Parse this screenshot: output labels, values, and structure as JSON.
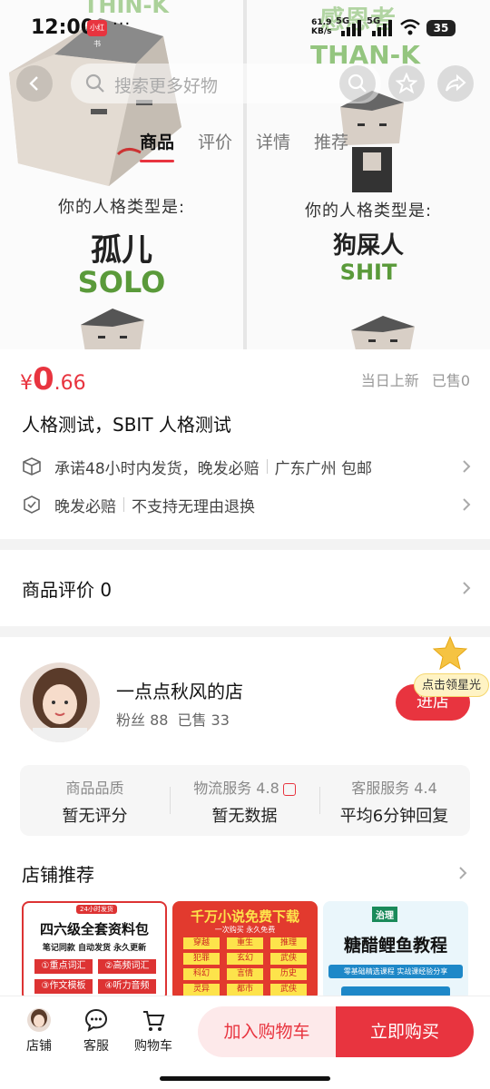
{
  "status_bar": {
    "time": "12:00",
    "app_badge": "小红书",
    "dots": "···",
    "speed_value": "61.9",
    "speed_unit": "KB/s",
    "net1": "5G",
    "net2": "5G",
    "battery": "35"
  },
  "hero": {
    "left_top_en": "THIN-K",
    "left_caption": "你的人格类型是:",
    "left_type_cn": "孤儿",
    "left_type_en": "SOLO",
    "right_top_cn": "感恩者",
    "right_top_en": "THAN-K",
    "right_caption": "你的人格类型是:",
    "right_type_cn": "狗屎人",
    "right_type_en": "SHIT"
  },
  "nav": {
    "search_placeholder": "搜索更多好物",
    "icons": [
      "back-icon",
      "search-icon",
      "star-icon",
      "share-icon"
    ],
    "tabs": [
      "商品",
      "评价",
      "详情",
      "推荐"
    ],
    "active_tab": 0
  },
  "product": {
    "currency": "¥",
    "price_int": "0",
    "price_dec": ".66",
    "listed": "当日上新",
    "sold": "已售0",
    "title": "人格测试，SBIT 人格测试",
    "service1": "承诺48小时内发货，晚发必赔",
    "service1_loc": "广东广州 包邮",
    "service2a": "晚发必赔",
    "service2b": "不支持无理由退换"
  },
  "reviews": {
    "label": "商品评价 0"
  },
  "shop": {
    "name": "一点点秋风的店",
    "fans": "粉丝 88",
    "sold": "已售 33",
    "enter_label": "进店",
    "star_badge": "点击领星光",
    "ratings": [
      {
        "label": "商品品质",
        "value": "暂无评分"
      },
      {
        "label": "物流服务 4.8",
        "value": "暂无数据"
      },
      {
        "label": "客服服务 4.4",
        "value": "平均6分钟回复"
      }
    ]
  },
  "recommend": {
    "title": "店铺推荐",
    "cards": [
      {
        "tag": "24小时发货",
        "title": "四六级全套资料包",
        "sub": "笔记同款 自动发货 永久更新",
        "items": [
          "①重点词汇",
          "②高频词汇",
          "③作文模板",
          "④听力音频"
        ]
      },
      {
        "title": "千万小说免费下载",
        "sub": "一次购买 永久免费",
        "items": [
          "穿越",
          "重生",
          "推理",
          "犯罪",
          "玄幻",
          "武侠",
          "科幻",
          "言情",
          "历史",
          "灵异",
          "都市",
          "武侠"
        ]
      },
      {
        "brand": "治理",
        "title": "糖醋鲤鱼教程",
        "sub": "零基础精选课程 实战课经验分享"
      }
    ]
  },
  "bottom_bar": {
    "shop": "店铺",
    "service": "客服",
    "cart": "购物车",
    "add_cart": "加入购物车",
    "buy_now": "立即购买"
  },
  "colors": {
    "accent": "#e8343f",
    "green_label": "#5a9a3a"
  }
}
